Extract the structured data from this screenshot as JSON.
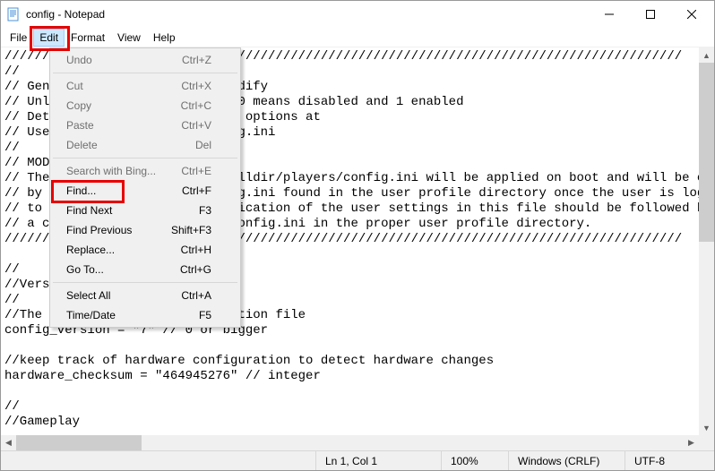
{
  "window": {
    "title": "config - Notepad"
  },
  "menubar": {
    "items": [
      "File",
      "Edit",
      "Format",
      "View",
      "Help"
    ],
    "active_index": 1
  },
  "edit_menu": {
    "groups": [
      [
        {
          "label": "Undo",
          "shortcut": "Ctrl+Z",
          "enabled": false
        }
      ],
      [
        {
          "label": "Cut",
          "shortcut": "Ctrl+X",
          "enabled": false
        },
        {
          "label": "Copy",
          "shortcut": "Ctrl+C",
          "enabled": false
        },
        {
          "label": "Paste",
          "shortcut": "Ctrl+V",
          "enabled": false
        },
        {
          "label": "Delete",
          "shortcut": "Del",
          "enabled": false
        }
      ],
      [
        {
          "label": "Search with Bing...",
          "shortcut": "Ctrl+E",
          "enabled": false
        },
        {
          "label": "Find...",
          "shortcut": "Ctrl+F",
          "enabled": true,
          "highlight": true
        },
        {
          "label": "Find Next",
          "shortcut": "F3",
          "enabled": true
        },
        {
          "label": "Find Previous",
          "shortcut": "Shift+F3",
          "enabled": true
        },
        {
          "label": "Replace...",
          "shortcut": "Ctrl+H",
          "enabled": true
        },
        {
          "label": "Go To...",
          "shortcut": "Ctrl+G",
          "enabled": true
        }
      ],
      [
        {
          "label": "Select All",
          "shortcut": "Ctrl+A",
          "enabled": true
        },
        {
          "label": "Time/Date",
          "shortcut": "F5",
          "enabled": true
        }
      ]
    ]
  },
  "editor": {
    "text": "//////////////////////////////////////////////////////////////////////////////////////////\n//\n// Generated by game, do not modify\n// Unless otherwise specified, 0 means disabled and 1 enabled\n// Detailed descriptions of the options at\n// Used to create default config.ini\n//\n// MODIFY AT YOUR OWN RISK!\n// The settings stored in installdir/players/config.ini will be applied on boot and will be overridden.\n// by the settings in the config.ini found in the user profile directory once the user is logged in\n// to the profile. So any modification of the user settings in this file should be followed by\n// a copy of this file to the config.ini in the proper user profile directory.\n//////////////////////////////////////////////////////////////////////////////////////////\n\n//\n//Version\n//\n//The version of this configuration file\nconfig_version = \"7\" // 0 or bigger\n\n//keep track of hardware configuration to detect hardware changes\nhardware_checksum = \"464945276\" // integer\n\n//\n//Gameplay"
  },
  "statusbar": {
    "position": "Ln 1, Col 1",
    "zoom": "100%",
    "line_ending": "Windows (CRLF)",
    "encoding": "UTF-8"
  }
}
